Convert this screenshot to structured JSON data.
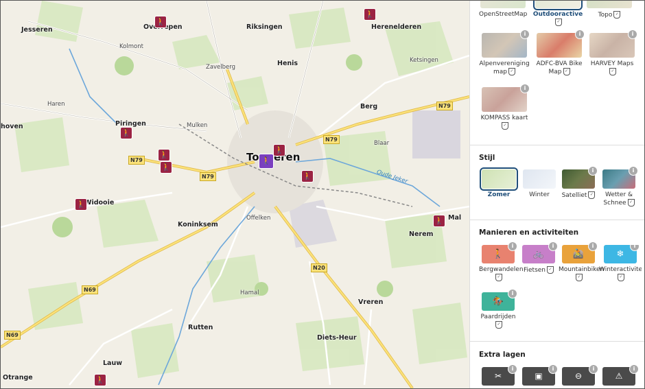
{
  "map": {
    "places": [
      {
        "name": "Jesseren",
        "cls": ""
      },
      {
        "name": "Overrepen",
        "cls": ""
      },
      {
        "name": "Riksingen",
        "cls": ""
      },
      {
        "name": "Herenelderen",
        "cls": ""
      },
      {
        "name": "Kolmont",
        "cls": "small"
      },
      {
        "name": "Zavelberg",
        "cls": "small"
      },
      {
        "name": "Henis",
        "cls": ""
      },
      {
        "name": "Ketsingen",
        "cls": "small"
      },
      {
        "name": "Haren",
        "cls": "small"
      },
      {
        "name": "Berg",
        "cls": ""
      },
      {
        "name": "Piringen",
        "cls": ""
      },
      {
        "name": "Mulken",
        "cls": "small"
      },
      {
        "name": "Blaar",
        "cls": "small"
      },
      {
        "name": "Tongeren",
        "cls": "big"
      },
      {
        "name": "Widooie",
        "cls": ""
      },
      {
        "name": "Koninksem",
        "cls": ""
      },
      {
        "name": "Offelken",
        "cls": "small"
      },
      {
        "name": "Mal",
        "cls": ""
      },
      {
        "name": "Nerem",
        "cls": ""
      },
      {
        "name": "Hamal",
        "cls": "small"
      },
      {
        "name": "Vreren",
        "cls": ""
      },
      {
        "name": "Rutten",
        "cls": ""
      },
      {
        "name": "Diets-Heur",
        "cls": ""
      },
      {
        "name": "Lauw",
        "cls": ""
      },
      {
        "name": "Otrange",
        "cls": ""
      },
      {
        "name": "hoven",
        "cls": ""
      }
    ],
    "roads": [
      "N79",
      "N79",
      "N79",
      "N79",
      "N20",
      "N69",
      "N69"
    ],
    "river_label": "Oude Jeker"
  },
  "panel": {
    "base_maps": [
      {
        "label": "OpenStreetMap",
        "check": false,
        "selected": false,
        "info": false
      },
      {
        "label": "Outdooractive",
        "check": true,
        "selected": true,
        "info": false
      },
      {
        "label": "Topo",
        "check": true,
        "selected": false,
        "info": false
      },
      {
        "label": "Alpenvereniging map",
        "check": true,
        "selected": false,
        "info": true
      },
      {
        "label": "ADFC-BVA Bike Map",
        "check": true,
        "selected": false,
        "info": true
      },
      {
        "label": "HARVEY Maps",
        "check": true,
        "selected": false,
        "info": true
      },
      {
        "label": "KOMPASS kaart",
        "check": true,
        "selected": false,
        "info": true
      }
    ],
    "stijl": {
      "title": "Stijl",
      "items": [
        {
          "label": "Zomer",
          "check": false,
          "selected": true,
          "info": false
        },
        {
          "label": "Winter",
          "check": false,
          "selected": false,
          "info": false
        },
        {
          "label": "Satelliet",
          "check": true,
          "selected": false,
          "info": true
        },
        {
          "label": "Wetter & Schnee",
          "check": true,
          "selected": false,
          "info": true
        }
      ]
    },
    "activities": {
      "title": "Manieren en activiteiten",
      "items": [
        {
          "label": "Bergwandelen",
          "check": true,
          "color": "#e8826f",
          "icon": "🚶"
        },
        {
          "label": "Fietsen",
          "check": true,
          "color": "#c77fc9",
          "icon": "🚲"
        },
        {
          "label": "Mountainbiken",
          "check": true,
          "color": "#e9a23b",
          "icon": "🚵"
        },
        {
          "label": "Winteractiviteiten",
          "check": true,
          "color": "#3db7e4",
          "icon": "❄"
        },
        {
          "label": "Paardrijden",
          "check": true,
          "color": "#3fb39a",
          "icon": "🏇"
        }
      ]
    },
    "extra": {
      "title": "Extra lagen",
      "items": [
        "✂",
        "▣",
        "⊖",
        "⚠"
      ]
    }
  }
}
